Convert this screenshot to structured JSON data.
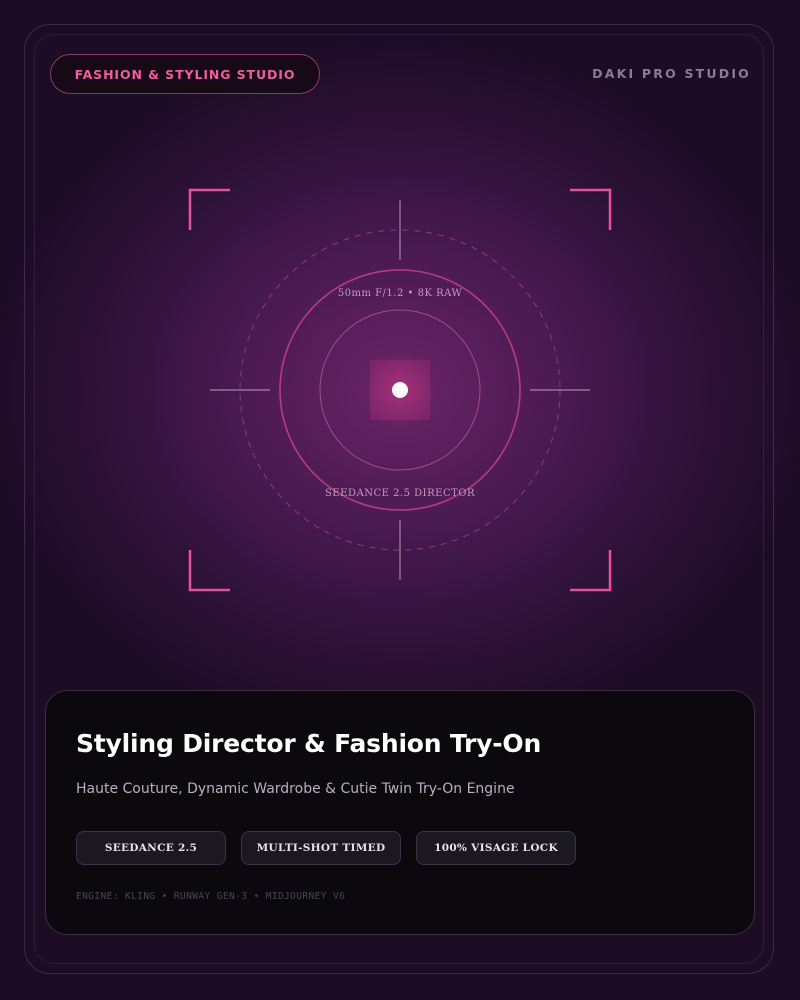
{
  "header": {
    "studio_label": "FASHION & STYLING STUDIO",
    "brand": "DAKI PRO STUDIO"
  },
  "viewfinder": {
    "top_readout": "50mm F/1.2 • 8K RAW",
    "bottom_readout": "SEEDANCE 2.5 DIRECTOR"
  },
  "card": {
    "title": "Styling Director & Fashion Try-On",
    "subtitle": "Haute Couture, Dynamic Wardrobe & Cutie Twin Try-On Engine",
    "tags": [
      "SEEDANCE 2.5",
      "MULTI-SHOT TIMED",
      "100% VISAGE LOCK"
    ],
    "engine_line": "ENGINE: KLING • RUNWAY GEN-3 • MIDJOURNEY V6"
  },
  "colors": {
    "accent_pink": "#e8509a",
    "background": "#2e1238",
    "card_background": "#0b090d"
  }
}
